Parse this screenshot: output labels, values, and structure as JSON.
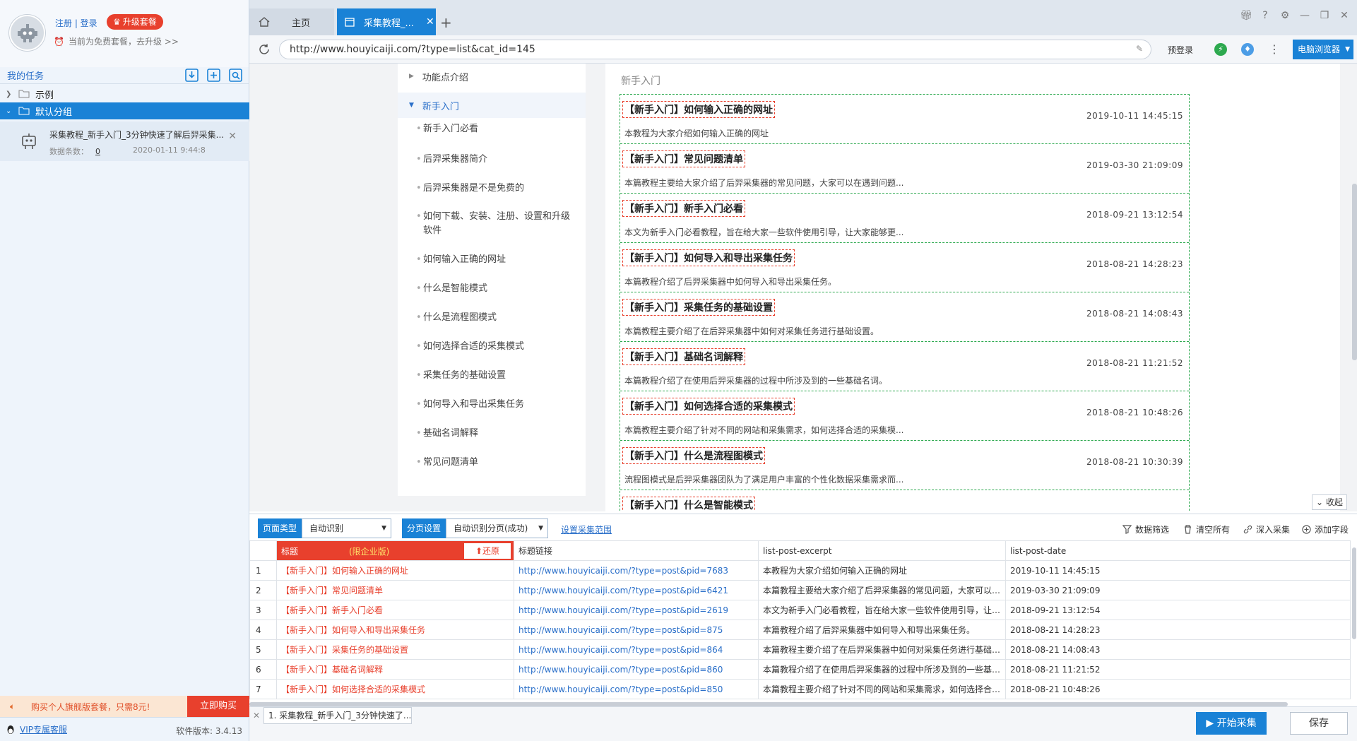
{
  "sidebar": {
    "login": "注册 | 登录",
    "upgrade": "升级套餐",
    "plan": "当前为免费套餐，去升级 >>",
    "my_tasks": "我的任务",
    "groups": {
      "example": "示例",
      "default": "默认分组"
    },
    "task": {
      "name": "采集教程_新手入门_3分钟快速了解后羿采集...",
      "count_label": "数据条数：",
      "count": "0",
      "date": "2020-01-11 9:44:8"
    },
    "promo": {
      "text": "购买个人旗舰版套餐，只需8元!",
      "button": "立即购买"
    },
    "vip": "VIP专属客服",
    "version": "软件版本: 3.4.13"
  },
  "tabs": {
    "home": "主页",
    "active": "采集教程_...",
    "new": "+"
  },
  "address": {
    "url": "http://www.houyicaiji.com/?type=list&cat_id=145",
    "prelogin": "预登录",
    "browser": "电脑浏览器"
  },
  "web": {
    "nav_top": [
      "功能点介绍",
      "新手入门"
    ],
    "nav_sub": [
      "新手入门必看",
      "后羿采集器简介",
      "后羿采集器是不是免费的",
      "如何下载、安装、注册、设置和升级软件",
      "如何输入正确的网址",
      "什么是智能模式",
      "什么是流程图模式",
      "如何选择合适的采集模式",
      "采集任务的基础设置",
      "如何导入和导出采集任务",
      "基础名词解释",
      "常见问题清单"
    ],
    "section_title": "新手入门",
    "posts": [
      {
        "title": "【新手入门】如何输入正确的网址",
        "date": "2019-10-11 14:45:15",
        "excerpt": "本教程为大家介绍如何输入正确的网址"
      },
      {
        "title": "【新手入门】常见问题清单",
        "date": "2019-03-30 21:09:09",
        "excerpt": "本篇教程主要给大家介绍了后羿采集器的常见问题，大家可以在遇到问题..."
      },
      {
        "title": "【新手入门】新手入门必看",
        "date": "2018-09-21 13:12:54",
        "excerpt": "本文为新手入门必看教程，旨在给大家一些软件使用引导，让大家能够更..."
      },
      {
        "title": "【新手入门】如何导入和导出采集任务",
        "date": "2018-08-21 14:28:23",
        "excerpt": "本篇教程介绍了后羿采集器中如何导入和导出采集任务。"
      },
      {
        "title": "【新手入门】采集任务的基础设置",
        "date": "2018-08-21 14:08:43",
        "excerpt": "本篇教程主要介绍了在后羿采集器中如何对采集任务进行基础设置。"
      },
      {
        "title": "【新手入门】基础名词解释",
        "date": "2018-08-21 11:21:52",
        "excerpt": "本篇教程介绍了在使用后羿采集器的过程中所涉及到的一些基础名词。"
      },
      {
        "title": "【新手入门】如何选择合适的采集模式",
        "date": "2018-08-21 10:48:26",
        "excerpt": "本篇教程主要介绍了针对不同的网站和采集需求，如何选择合适的采集模..."
      },
      {
        "title": "【新手入门】什么是流程图模式",
        "date": "2018-08-21 10:30:39",
        "excerpt": "流程图模式是后羿采集器团队为了满足用户丰富的个性化数据采集需求而..."
      },
      {
        "title": "【新手入门】什么是智能模式",
        "date": "",
        "excerpt": ""
      }
    ],
    "collapse": "收起"
  },
  "config": {
    "page_type_label": "页面类型",
    "page_type_value": "自动识别",
    "paging_label": "分页设置",
    "paging_value": "自动识别分页(成功)",
    "range_link": "设置采集范围",
    "actions": [
      "数据筛选",
      "清空所有",
      "深入采集",
      "添加字段"
    ]
  },
  "table": {
    "headers": {
      "title": "标题",
      "title_tag": "(限企业版)",
      "restore": "还原",
      "link": "标题链接",
      "excerpt": "list-post-excerpt",
      "date": "list-post-date"
    },
    "rows": [
      {
        "title": "【新手入门】如何输入正确的网址",
        "link": "http://www.houyicaiji.com/?type=post&pid=7683",
        "excerpt": "本教程为大家介绍如何输入正确的网址",
        "date": "2019-10-11 14:45:15"
      },
      {
        "title": "【新手入门】常见问题清单",
        "link": "http://www.houyicaiji.com/?type=post&pid=6421",
        "excerpt": "本篇教程主要给大家介绍了后羿采集器的常见问题，大家可以在遇到问题时先...",
        "date": "2019-03-30 21:09:09"
      },
      {
        "title": "【新手入门】新手入门必看",
        "link": "http://www.houyicaiji.com/?type=post&pid=2619",
        "excerpt": "本文为新手入门必看教程，旨在给大家一些软件使用引导，让大家能够更快地...",
        "date": "2018-09-21 13:12:54"
      },
      {
        "title": "【新手入门】如何导入和导出采集任务",
        "link": "http://www.houyicaiji.com/?type=post&pid=875",
        "excerpt": "本篇教程介绍了后羿采集器中如何导入和导出采集任务。",
        "date": "2018-08-21 14:28:23"
      },
      {
        "title": "【新手入门】采集任务的基础设置",
        "link": "http://www.houyicaiji.com/?type=post&pid=864",
        "excerpt": "本篇教程主要介绍了在后羿采集器中如何对采集任务进行基础设置。",
        "date": "2018-08-21 14:08:43"
      },
      {
        "title": "【新手入门】基础名词解释",
        "link": "http://www.houyicaiji.com/?type=post&pid=860",
        "excerpt": "本篇教程介绍了在使用后羿采集器的过程中所涉及到的一些基础名词。",
        "date": "2018-08-21 11:21:52"
      },
      {
        "title": "【新手入门】如何选择合适的采集模式",
        "link": "http://www.houyicaiji.com/?type=post&pid=850",
        "excerpt": "本篇教程主要介绍了针对不同的网站和采集需求，如何选择合适的采集模式。",
        "date": "2018-08-21 10:48:26"
      }
    ]
  },
  "bottom": {
    "task_tab": "1. 采集教程_新手入门_3分钟快速了...",
    "start": "开始采集",
    "save": "保存"
  },
  "colors": {
    "accent": "#1a82d6",
    "brand_red": "#e8402d",
    "link": "#2a6fc9",
    "select_green": "#2da94f"
  }
}
